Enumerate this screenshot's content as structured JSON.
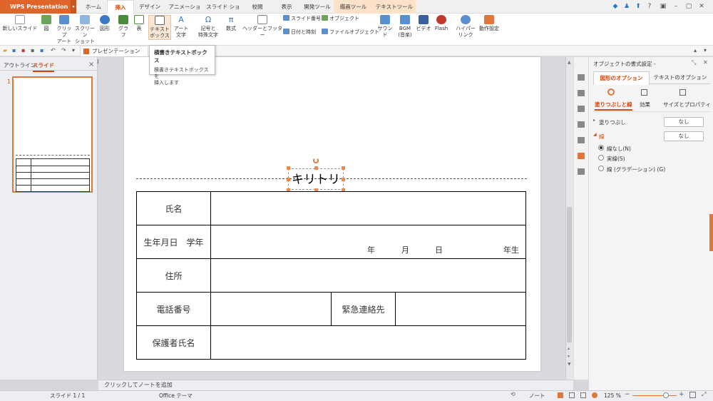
{
  "app": {
    "name": "WPS Presentation",
    "dropdown": "▾"
  },
  "tabs": [
    {
      "label": "ホーム",
      "state": "normal"
    },
    {
      "label": "挿入",
      "state": "active"
    },
    {
      "label": "デザイン",
      "state": "normal"
    },
    {
      "label": "アニメーション",
      "state": "normal"
    },
    {
      "label": "スライド ショー",
      "state": "normal"
    },
    {
      "label": "校閲",
      "state": "normal"
    },
    {
      "label": "表示",
      "state": "normal"
    },
    {
      "label": "開発ツール",
      "state": "normal"
    },
    {
      "label": "描画ツール",
      "state": "contextual"
    },
    {
      "label": "テキストツール",
      "state": "contextual"
    }
  ],
  "ribbon": {
    "new_slide": "新しいスライド",
    "figure": "図",
    "clipart_1": "クリップ",
    "clipart_2": "アート",
    "screenshot_1": "スクリーン",
    "screenshot_2": "ショット",
    "shape": "図形",
    "graph": "グラフ",
    "table": "表",
    "textbox_1": "テキスト",
    "textbox_2": "ボックス",
    "art_text_1": "アート",
    "art_text_2": "文字",
    "symbol_1": "記号と",
    "symbol_2": "特殊文字",
    "formula": "数式",
    "header_footer": "ヘッダーとフッター",
    "slide_number": "スライド番号",
    "object": "オブジェクト",
    "date_time": "日付と時刻",
    "file_object": "ファイルオブジェクト",
    "sound": "サウンド",
    "bgm_1": "BGM",
    "bgm_2": "(音楽)",
    "video": "ビデオ",
    "flash": "Flash",
    "hyperlink_1": "ハイパー",
    "hyperlink_2": "リンク",
    "action": "動作設定"
  },
  "doc_tab": "プレゼンテーション1.pptx",
  "tooltip": {
    "title": "横書きテキストボックス",
    "desc_1": "横書きテキストボックスを",
    "desc_2": "挿入します"
  },
  "left_pane": {
    "outline": "アウトライン",
    "slides": "スライド",
    "slide_num": "1",
    "close": "×"
  },
  "slide": {
    "kiritori": "キリトリ",
    "rows": {
      "name": "氏名",
      "birth": "生年月日　学年",
      "year": "年",
      "month": "月",
      "day": "日",
      "grade": "年生",
      "address": "住所",
      "phone": "電話番号",
      "emergency": "緊急連絡先",
      "guardian": "保護者氏名"
    }
  },
  "notes_placeholder": "クリックしてノートを追加",
  "status": {
    "slide": "スライド 1 / 1",
    "theme": "Office テーマ",
    "note": "ノート",
    "zoom": "125 %"
  },
  "panel": {
    "title": "オブジェクトの書式設定 -",
    "tab_shape": "図形のオプション",
    "tab_text": "テキストのオプション",
    "sub_fill": "塗りつぶしと線",
    "sub_effect": "効果",
    "sub_size": "サイズとプロパティ",
    "fill_label": "塗りつぶし",
    "fill_value": "なし",
    "line_label": "線",
    "line_value": "なし",
    "opt_none": "線なし(N)",
    "opt_solid": "実線(S)",
    "opt_grad": "線 (グラデーション) (G)"
  },
  "colors": {
    "accent": "#e0652b",
    "active_tab": "#d24a0e"
  }
}
